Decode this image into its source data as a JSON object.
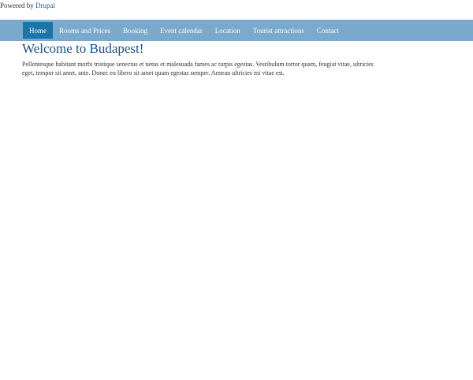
{
  "footer": {
    "powered_prefix": "Powered by",
    "powered_link": "Drupal"
  },
  "nav": {
    "items": [
      {
        "label": "Home",
        "active": true
      },
      {
        "label": "Rooms and Prices"
      },
      {
        "label": "Booking"
      },
      {
        "label": "Event calendar"
      },
      {
        "label": "Location"
      },
      {
        "label": "Tourist attractions"
      },
      {
        "label": "Contact"
      }
    ]
  },
  "main": {
    "title": "Welcome to Budapest!",
    "body": "Pellentesque habitant morbi tristique senectus et netus et malesuada fames ac turpis egestas. Vestibulum tortor quam, feugiat vitae, ultricies eget, tempor sit amet, ante. Donec eu libero sit amet quam egestas semper. Aenean ultricies mi vitae est."
  },
  "colors": {
    "nav_bg": "#7aa9cb",
    "nav_active": "#1b75a8",
    "title": "#1c4f8a",
    "link": "#1a5f9e"
  }
}
